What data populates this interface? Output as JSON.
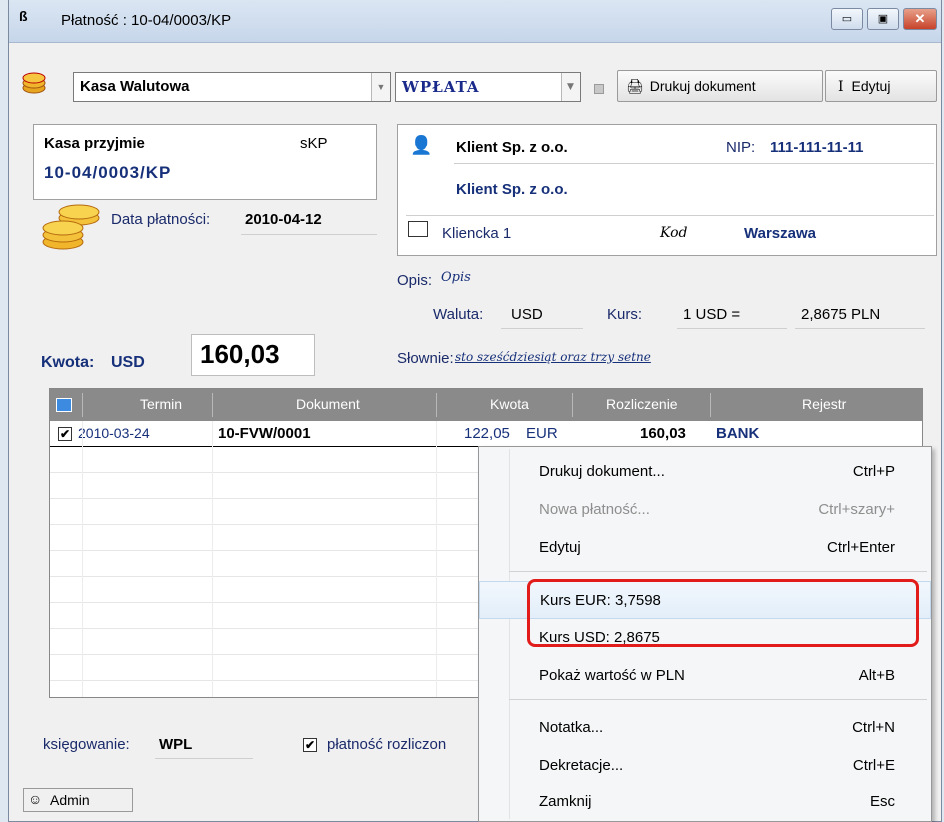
{
  "window": {
    "title": "Płatność : 10-04/0003/KP",
    "controls": [
      "▭",
      "▣",
      "✕"
    ]
  },
  "toolbar": {
    "cash_register": "Kasa Walutowa",
    "operation": "WPŁATA",
    "print_button": "Drukuj dokument",
    "edit_button": "Edytuj"
  },
  "doc": {
    "header": "Kasa przyjmie",
    "series": "sKP",
    "number": "10-04/0003/KP",
    "date_label": "Data płatności:",
    "date_value": "2010-04-12"
  },
  "client": {
    "name": "Klient Sp. z o.o.",
    "nip_label": "NIP:",
    "nip_value": "111-111-11-11",
    "full_name": "Klient Sp. z o.o.",
    "street": "Kliencka 1",
    "postal_label": "Kod",
    "city": "Warszawa"
  },
  "details": {
    "desc_label": "Opis:",
    "desc_value": "Opis",
    "currency_label": "Waluta:",
    "currency_value": "USD",
    "rate_label": "Kurs:",
    "rate_unit": "1 USD =",
    "rate_value": "2,8675 PLN",
    "words_label": "Słownie:",
    "words_value": "sto sześćdziesiąt oraz trzy setne"
  },
  "amount": {
    "label": "Kwota:",
    "currency": "USD",
    "value": "160,03"
  },
  "table": {
    "columns": [
      "Termin",
      "Dokument",
      "Kwota",
      "Rozliczenie",
      "Rejestr"
    ],
    "rows": [
      {
        "checked": "✔",
        "date": "2010-03-24",
        "document": "10-FVW/0001",
        "amount": "122,05",
        "currency": "EUR",
        "settled": "160,03",
        "register": "BANK"
      }
    ]
  },
  "footer": {
    "posting_label": "księgowanie:",
    "posting_value": "WPL",
    "settled_check": "✔",
    "settled_label": "płatność rozliczon"
  },
  "status": {
    "user": "Admin"
  },
  "context_menu": {
    "items": [
      {
        "label": "Drukuj dokument...",
        "shortcut": "Ctrl+P"
      },
      {
        "label": "Nowa płatność...",
        "shortcut": "Ctrl+szary+"
      },
      {
        "label": "Edytuj",
        "shortcut": "Ctrl+Enter"
      },
      {
        "label": "Kurs EUR: 3,7598",
        "shortcut": ""
      },
      {
        "label": "Kurs USD: 2,8675",
        "shortcut": ""
      },
      {
        "label": "Pokaż wartość w PLN",
        "shortcut": "Alt+B"
      },
      {
        "label": "Notatka...",
        "shortcut": "Ctrl+N"
      },
      {
        "label": "Dekretacje...",
        "shortcut": "Ctrl+E"
      },
      {
        "label": "Zamknij",
        "shortcut": "Esc"
      }
    ]
  },
  "colors": {
    "highlight": "#e21b1b",
    "navy": "#16307a",
    "grid_header": "#8a8a8a"
  }
}
